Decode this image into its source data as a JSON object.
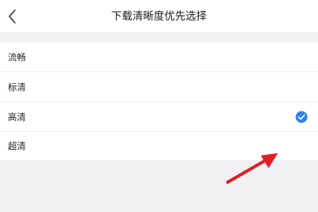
{
  "header": {
    "title": "下载清晰度优先选择",
    "back_icon": "chevron-left-icon"
  },
  "options": [
    {
      "label": "流畅",
      "selected": false
    },
    {
      "label": "标清",
      "selected": false
    },
    {
      "label": "高清",
      "selected": true
    },
    {
      "label": "超清",
      "selected": false
    }
  ],
  "colors": {
    "accent": "#2f80ed",
    "annotation": "#e31e24"
  },
  "icons": {
    "selected": "check-circle-icon",
    "annotation": "red-arrow-icon"
  }
}
